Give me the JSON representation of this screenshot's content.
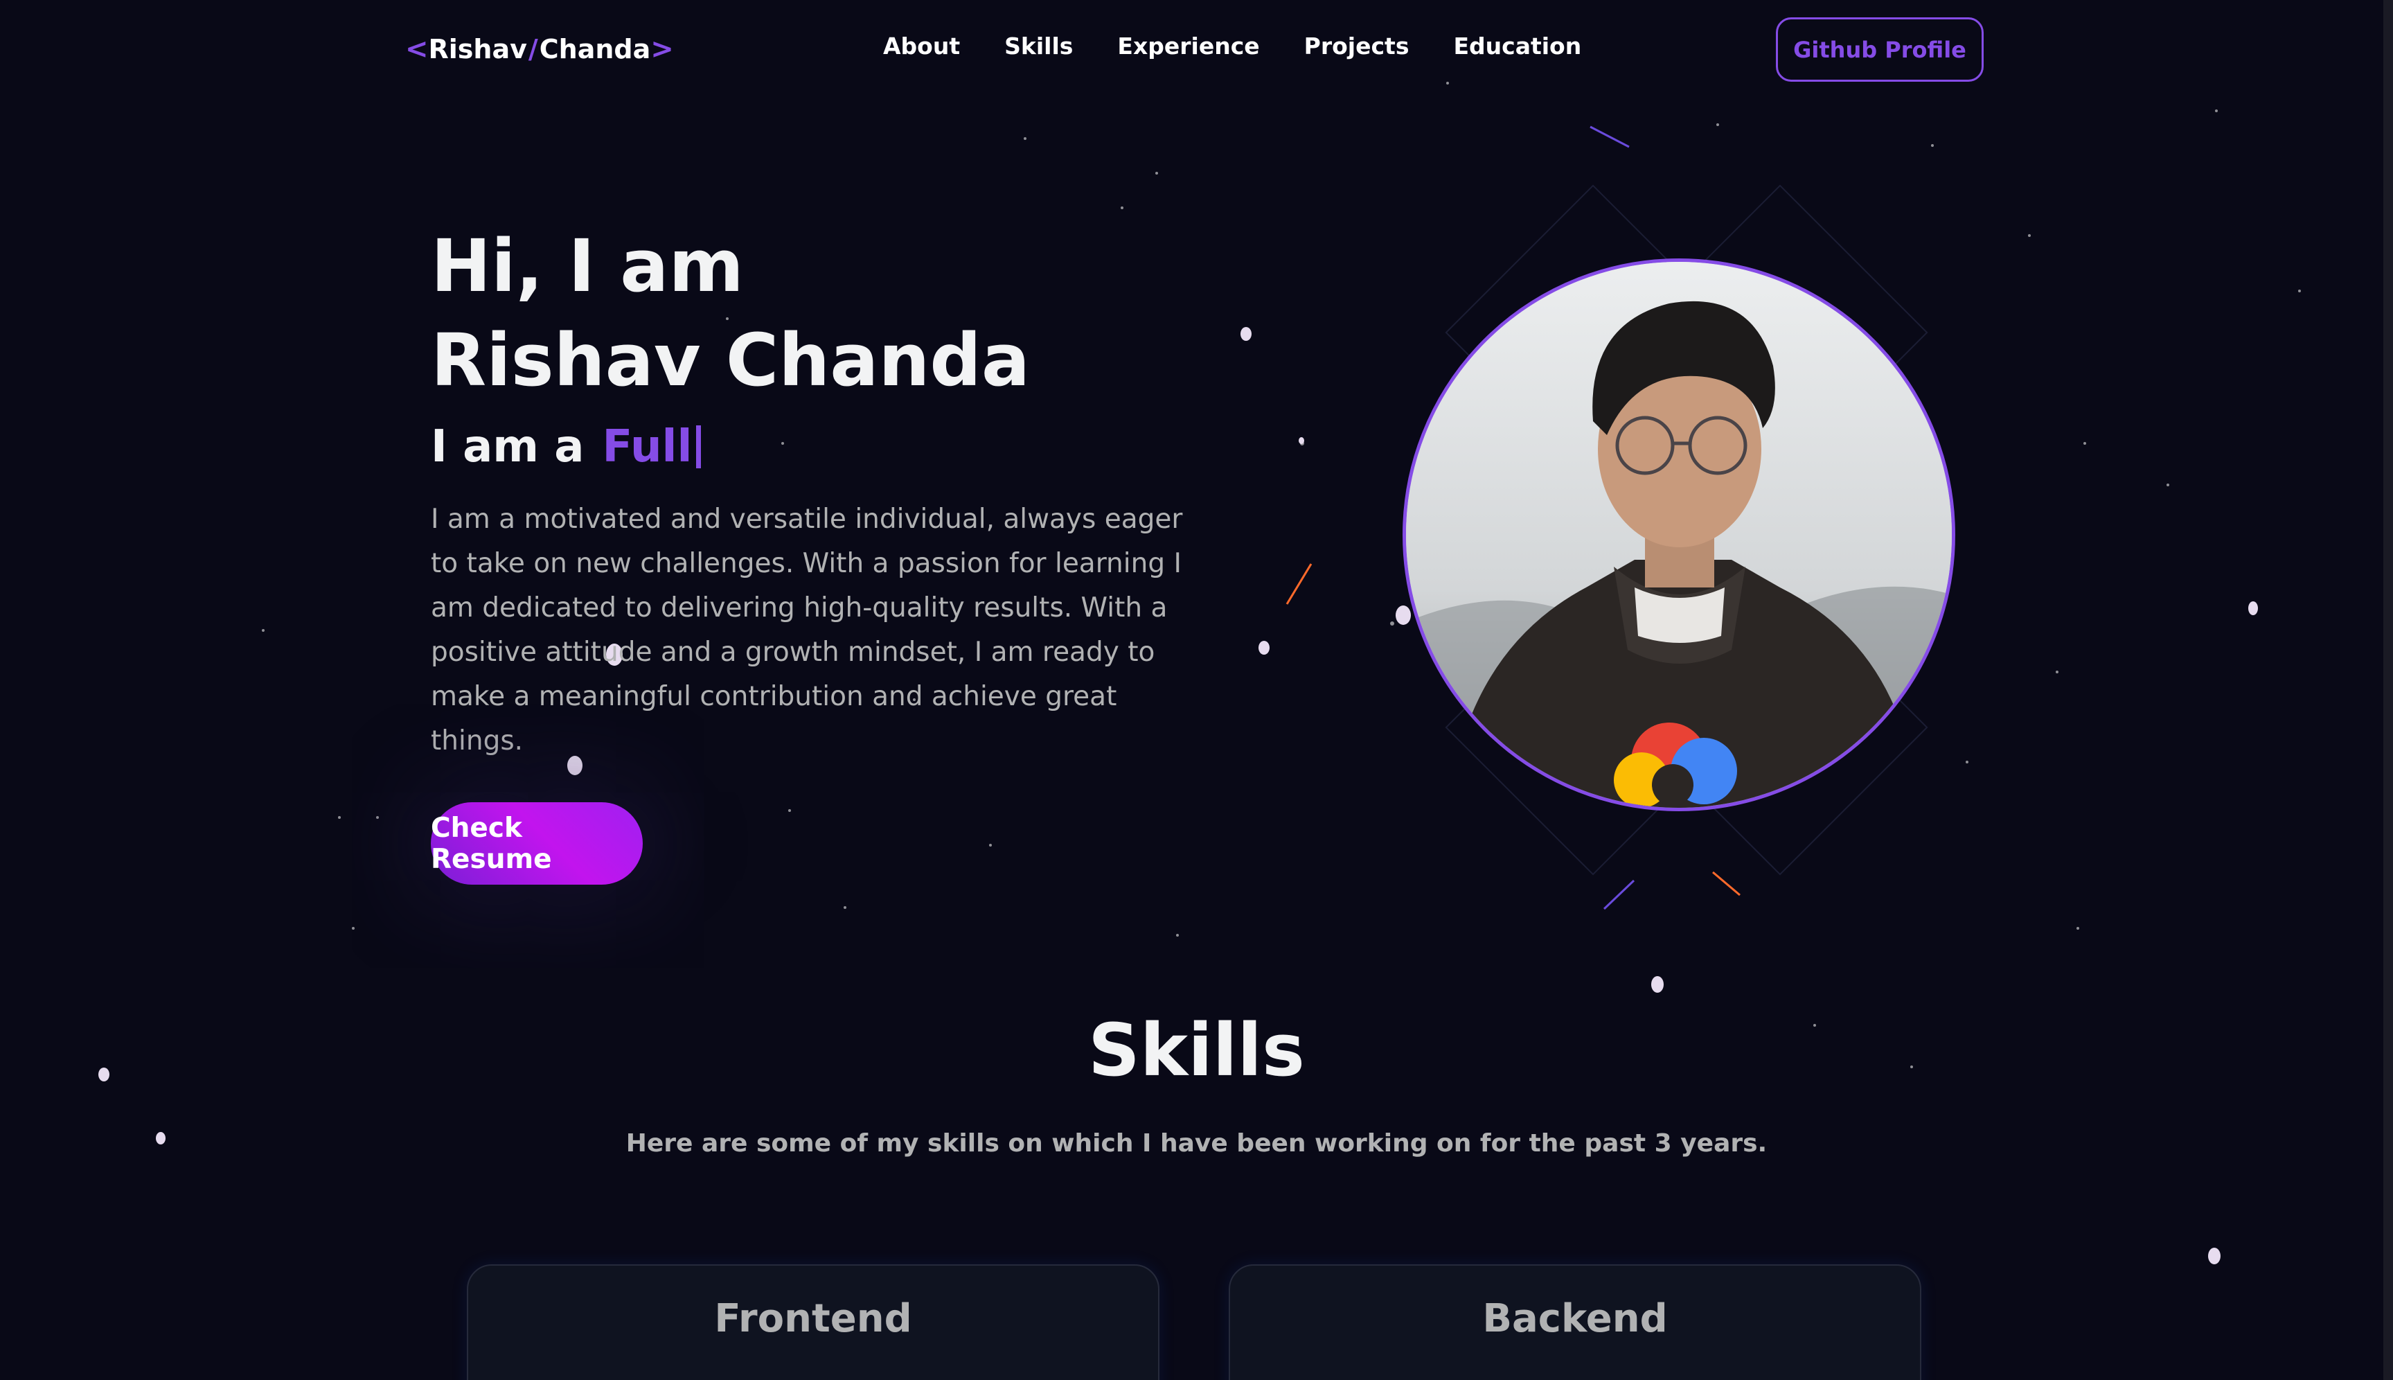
{
  "nav": {
    "logo": {
      "open": "<",
      "first": "Rishav",
      "slash": "/",
      "last": "Chanda",
      "close": ">"
    },
    "links": [
      "About",
      "Skills",
      "Experience",
      "Projects",
      "Education"
    ],
    "github_label": "Github Profile"
  },
  "hero": {
    "greeting": "Hi, I am",
    "name": "Rishav Chanda",
    "role_prefix": "I am a",
    "role_typed": "Full",
    "description": "I am a motivated and versatile individual, always eager to take on new challenges. With a passion for learning I am dedicated to delivering high-quality results. With a positive attitude and a growth mindset, I am ready to make a meaningful contribution and achieve great things.",
    "resume_label": "Check Resume"
  },
  "skills": {
    "title": "Skills",
    "subtitle": "Here are some of my skills on which I have been working on for the past 3 years.",
    "cards": [
      "Frontend",
      "Backend"
    ]
  },
  "colors": {
    "background": "#090917",
    "accent": "#854ce6",
    "text_primary": "#f2f3f4",
    "text_secondary": "#b1b2b3",
    "button_gradient_start": "#c214ee",
    "button_gradient_end": "#7a1fd6"
  }
}
